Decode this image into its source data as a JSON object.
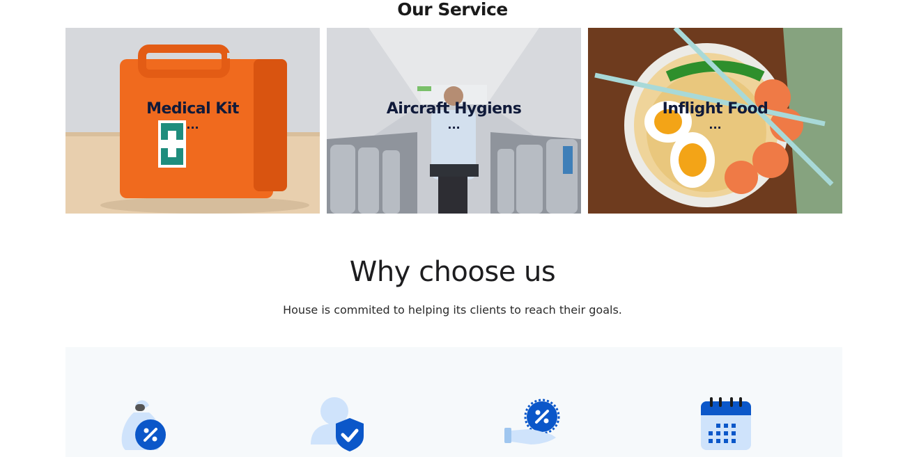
{
  "service": {
    "title": "Our Service",
    "cards": [
      {
        "title": "Medical Kit",
        "dots": "..."
      },
      {
        "title": "Aircraft Hygiens",
        "dots": "..."
      },
      {
        "title": "Inflight Food",
        "dots": "..."
      }
    ]
  },
  "why": {
    "title": "Why choose us",
    "subtitle": "House is commited to helping its clients to reach their goals."
  },
  "features": {
    "icons": [
      "discount-bag-icon",
      "protected-user-icon",
      "discount-offer-hand-icon",
      "calendar-icon"
    ]
  },
  "colors": {
    "brand_blue": "#0b57c9",
    "light_blue": "#cfe3fb",
    "heading": "#101a3a"
  }
}
